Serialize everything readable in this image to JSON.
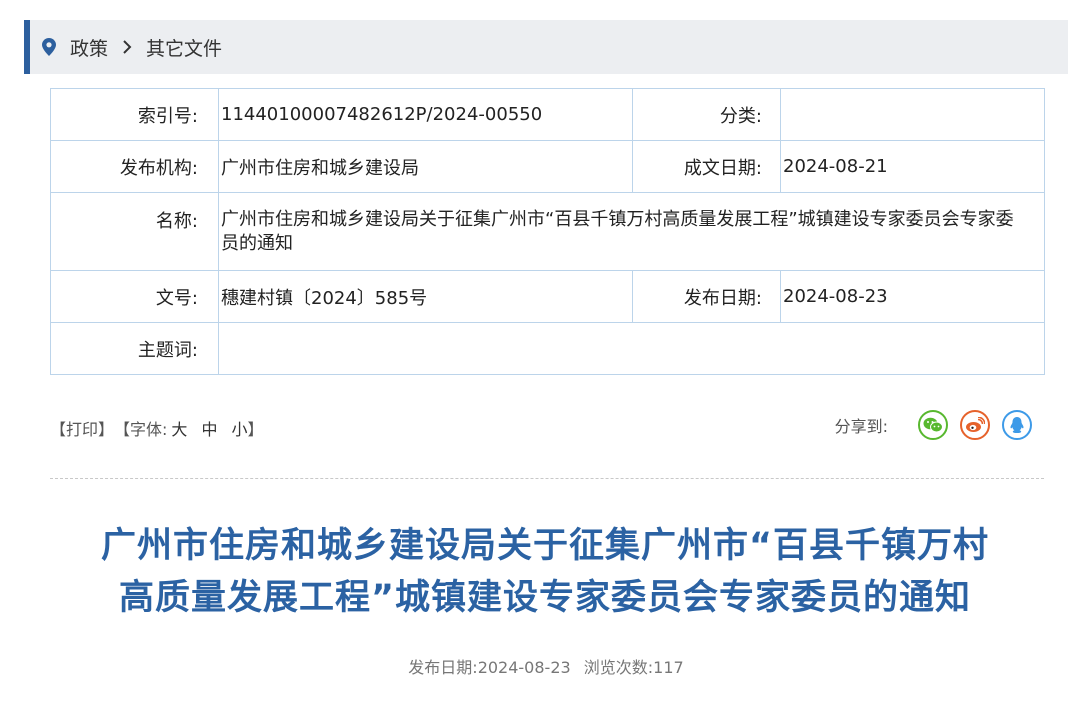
{
  "breadcrumb": {
    "items": [
      "政策",
      "其它文件"
    ],
    "icon": "location-pin-icon",
    "accent": "#2c5f9e"
  },
  "info": {
    "index_label": "索引号:",
    "index_value": "11440100007482612P/2024-00550",
    "category_label": "分类:",
    "category_value": "",
    "publisher_label": "发布机构:",
    "publisher_value": "广州市住房和城乡建设局",
    "created_date_label": "成文日期:",
    "created_date_value": "2024-08-21",
    "name_label": "名称:",
    "name_value": "广州市住房和城乡建设局关于征集广州市“百县千镇万村高质量发展工程”城镇建设专家委员会专家委员的通知",
    "doc_no_label": "文号:",
    "doc_no_value": "穗建村镇〔2024〕585号",
    "publish_date_label": "发布日期:",
    "publish_date_value": "2024-08-23",
    "keywords_label": "主题词:",
    "keywords_value": ""
  },
  "tools": {
    "print": "【打印】",
    "font_prefix": "【字体:",
    "font_large": "大",
    "font_medium": "中",
    "font_small": "小",
    "font_suffix": "】"
  },
  "share": {
    "label": "分享到:",
    "icons": [
      "wechat-icon",
      "weibo-icon",
      "qq-icon"
    ],
    "colors": {
      "wechat": "#58b82f",
      "weibo": "#e6622b",
      "qq": "#3d9ae8"
    }
  },
  "article": {
    "title_line1": "广州市住房和城乡建设局关于征集广州市“百县千镇万村",
    "title_line2": "高质量发展工程”城镇建设专家委员会专家委员的通知",
    "title_color": "#2b62a3",
    "publish_label": "发布日期:",
    "publish_date": "2024-08-23",
    "views_label": "浏览次数:",
    "views": "117"
  }
}
